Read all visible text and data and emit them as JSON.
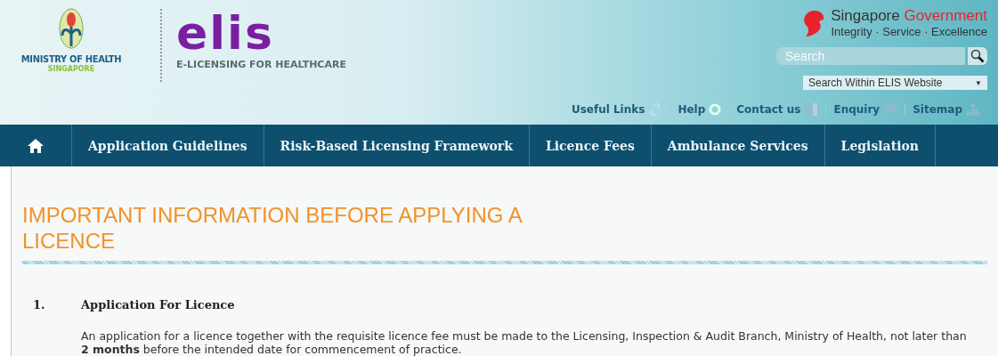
{
  "header": {
    "ministry": {
      "name": "MINISTRY OF HEALTH",
      "country": "SINGAPORE"
    },
    "elis": {
      "wordmark": "elis",
      "tagline": "E-LICENSING FOR HEALTHCARE"
    },
    "government": {
      "name_part_1": "Singapore",
      "name_part_2": "Government",
      "motto": "Integrity · Service · Excellence"
    },
    "search": {
      "placeholder": "Search"
    },
    "scope": {
      "value": "Search Within ELIS Website",
      "caret": "▼"
    },
    "utility_links": [
      {
        "label": "Useful Links",
        "kind": "link"
      },
      {
        "label": "Help",
        "kind": "help"
      },
      {
        "label": "Contact us",
        "kind": "contact"
      },
      {
        "label": "Enquiry",
        "kind": "enquiry"
      },
      {
        "label": "Sitemap",
        "kind": "sitemap"
      }
    ]
  },
  "nav": {
    "items": [
      {
        "label": "Application Guidelines"
      },
      {
        "label": "Risk-Based Licensing Framework"
      },
      {
        "label": "Licence Fees"
      },
      {
        "label": "Ambulance Services"
      },
      {
        "label": "Legislation"
      }
    ]
  },
  "content": {
    "title": "IMPORTANT INFORMATION BEFORE APPLYING A LICENCE",
    "sections": [
      {
        "number": "1.",
        "heading": "Application For Licence",
        "text": "An application for a licence together with the requisite licence fee must be made to the Licensing, Inspection & Audit Branch, Ministry of Health, not later than **2 months** before the intended date for commencement of practice."
      }
    ]
  }
}
